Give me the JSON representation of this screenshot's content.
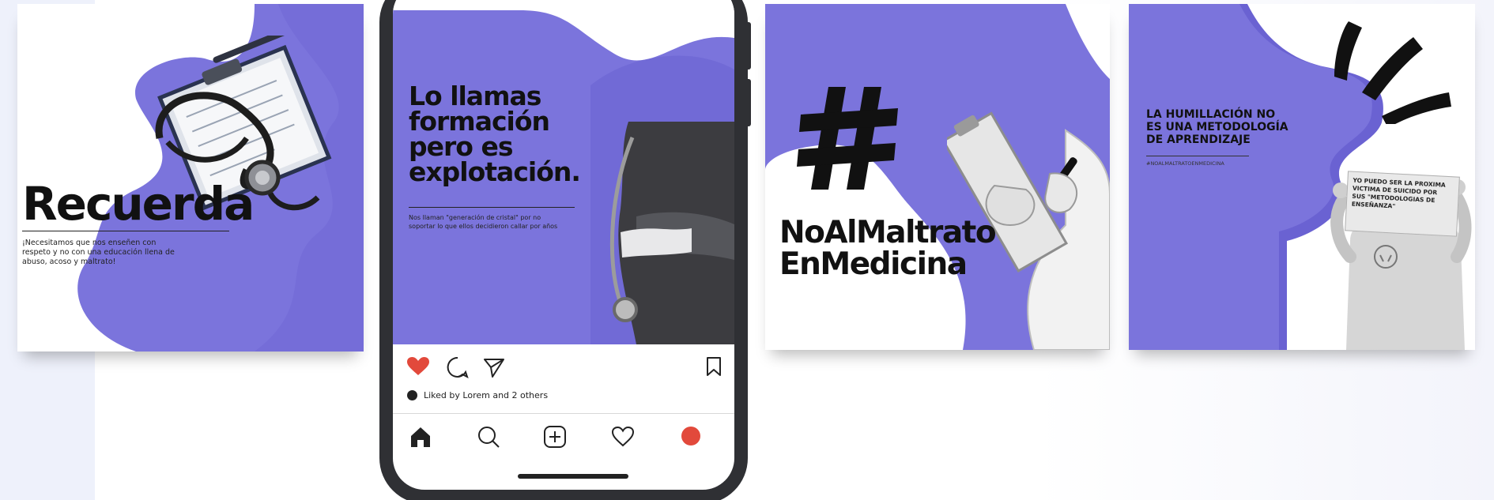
{
  "colors": {
    "accent": "#7b74dc",
    "accent_dark": "#6a62d2",
    "text": "#111111",
    "like": "#e2493b"
  },
  "card_recuerda": {
    "title": "Recuerda",
    "body_line1": "¡Necesitamos que nos enseñen con",
    "body_line2": "respeto y no con una educación llena de",
    "body_line3": "abuso, acoso y maltrato!"
  },
  "phone_post": {
    "headline_line1": "Lo llamas",
    "headline_line2": "formación",
    "headline_line3": "pero es",
    "headline_line4": "explotación.",
    "caption_line1": "Nos llaman \"generación de cristal\" por no",
    "caption_line2": "soportar lo que ellos decidieron callar por años",
    "liked_text": "Liked by Lorem and 2 others",
    "icons": {
      "like": "heart-filled-icon",
      "comment": "comment-icon",
      "share": "send-icon",
      "save": "bookmark-icon",
      "home": "home-icon",
      "search": "search-icon",
      "add": "add-post-icon",
      "activity": "heart-outline-icon",
      "profile": "profile-icon"
    }
  },
  "card_hashtag": {
    "symbol": "#",
    "line1": "NoAlMaltrato",
    "line2": "EnMedicina"
  },
  "card_humillacion": {
    "heading_line1": "LA HUMILLACIÓN NO",
    "heading_line2": "ES UNA METODOLOGÍA",
    "heading_line3": "DE APRENDIZAJE",
    "hashtag": "#NOALMALTRATOENMEDICINA",
    "sign_line1": "YO PUEDO SER LA PROXIMA",
    "sign_line2": "VICTIMA DE SUICIDO POR",
    "sign_line3": "SUS \"METODOLOGIAS DE",
    "sign_line4": "ENSEÑANZA\""
  }
}
